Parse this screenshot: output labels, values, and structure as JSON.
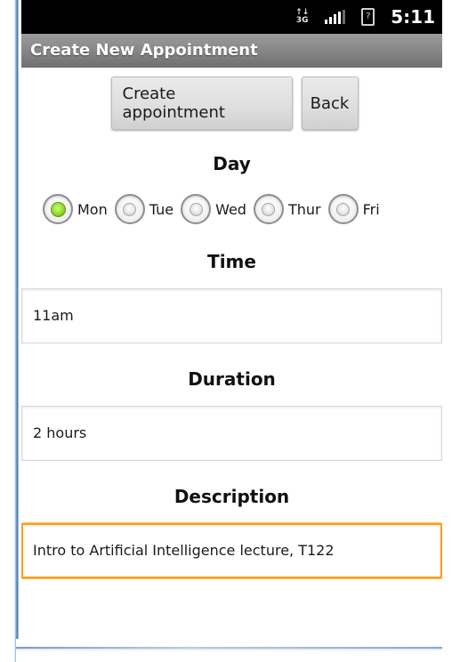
{
  "status_bar": {
    "network_label": "3G",
    "clock": "5:11",
    "sim_glyph": "?",
    "icons": [
      "network-3g-icon",
      "signal-icon",
      "sim-card-icon"
    ]
  },
  "app": {
    "title": "Create New Appointment"
  },
  "buttons": {
    "create_label": "Create appointment",
    "back_label": "Back"
  },
  "day": {
    "heading": "Day",
    "options": [
      {
        "label": "Mon",
        "checked": true
      },
      {
        "label": "Tue",
        "checked": false
      },
      {
        "label": "Wed",
        "checked": false
      },
      {
        "label": "Thur",
        "checked": false
      },
      {
        "label": "Fri",
        "checked": false
      }
    ]
  },
  "time": {
    "heading": "Time",
    "value": "11am"
  },
  "duration": {
    "heading": "Duration",
    "value": "2 hours"
  },
  "description": {
    "heading": "Description",
    "value": "Intro to Artificial Intelligence lecture, T122"
  },
  "colors": {
    "focus": "#ff9c1a",
    "radio_checked": "#8fd92a",
    "title_bar": "#848484",
    "status_bar": "#000000"
  }
}
